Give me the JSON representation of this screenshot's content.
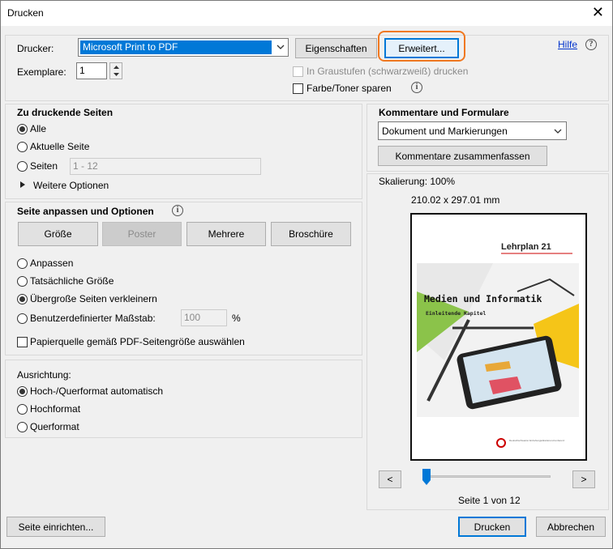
{
  "window": {
    "title": "Drucken",
    "close_glyph": "✕"
  },
  "printer": {
    "label": "Drucker:",
    "selected": "Microsoft Print to PDF",
    "properties_button": "Eigenschaften",
    "advanced_button": "Erweitert...",
    "help_link": "Hilfe",
    "copies_label": "Exemplare:",
    "copies_value": "1",
    "grayscale_label": "In Graustufen (schwarzweiß) drucken",
    "save_ink_label": "Farbe/Toner sparen"
  },
  "pages": {
    "heading": "Zu druckende Seiten",
    "all": "Alle",
    "current": "Aktuelle Seite",
    "pages_label": "Seiten",
    "pages_value": "1 - 12",
    "more_options": "Weitere Optionen"
  },
  "sizing": {
    "heading": "Seite anpassen und Optionen",
    "size_button": "Größe",
    "poster_button": "Poster",
    "multiple_button": "Mehrere",
    "booklet_button": "Broschüre",
    "fit": "Anpassen",
    "actual": "Tatsächliche Größe",
    "shrink": "Übergroße Seiten verkleinern",
    "custom": "Benutzerdefinierter Maßstab:",
    "custom_value": "100",
    "percent": "%",
    "paper_source": "Papierquelle gemäß PDF-Seitengröße auswählen"
  },
  "orientation": {
    "heading": "Ausrichtung:",
    "auto": "Hoch-/Querformat automatisch",
    "portrait": "Hochformat",
    "landscape": "Querformat"
  },
  "comments": {
    "heading": "Kommentare und Formulare",
    "selected": "Dokument und Markierungen",
    "summarize_button": "Kommentare zusammenfassen"
  },
  "preview": {
    "scale": "Skalierung: 100%",
    "dimensions": "210.02 x 297.01 mm",
    "doc_logo": "Lehrplan 21",
    "doc_title": "Medien und Informatik",
    "doc_subtitle": "Einleitende Kapitel",
    "doc_publisher": "Deutschschweizer Erziehungsdirektoren-Konferenz",
    "page_info": "Seite 1 von 12",
    "prev": "<",
    "next": ">"
  },
  "footer": {
    "page_setup": "Seite einrichten...",
    "print": "Drucken",
    "cancel": "Abbrechen"
  }
}
